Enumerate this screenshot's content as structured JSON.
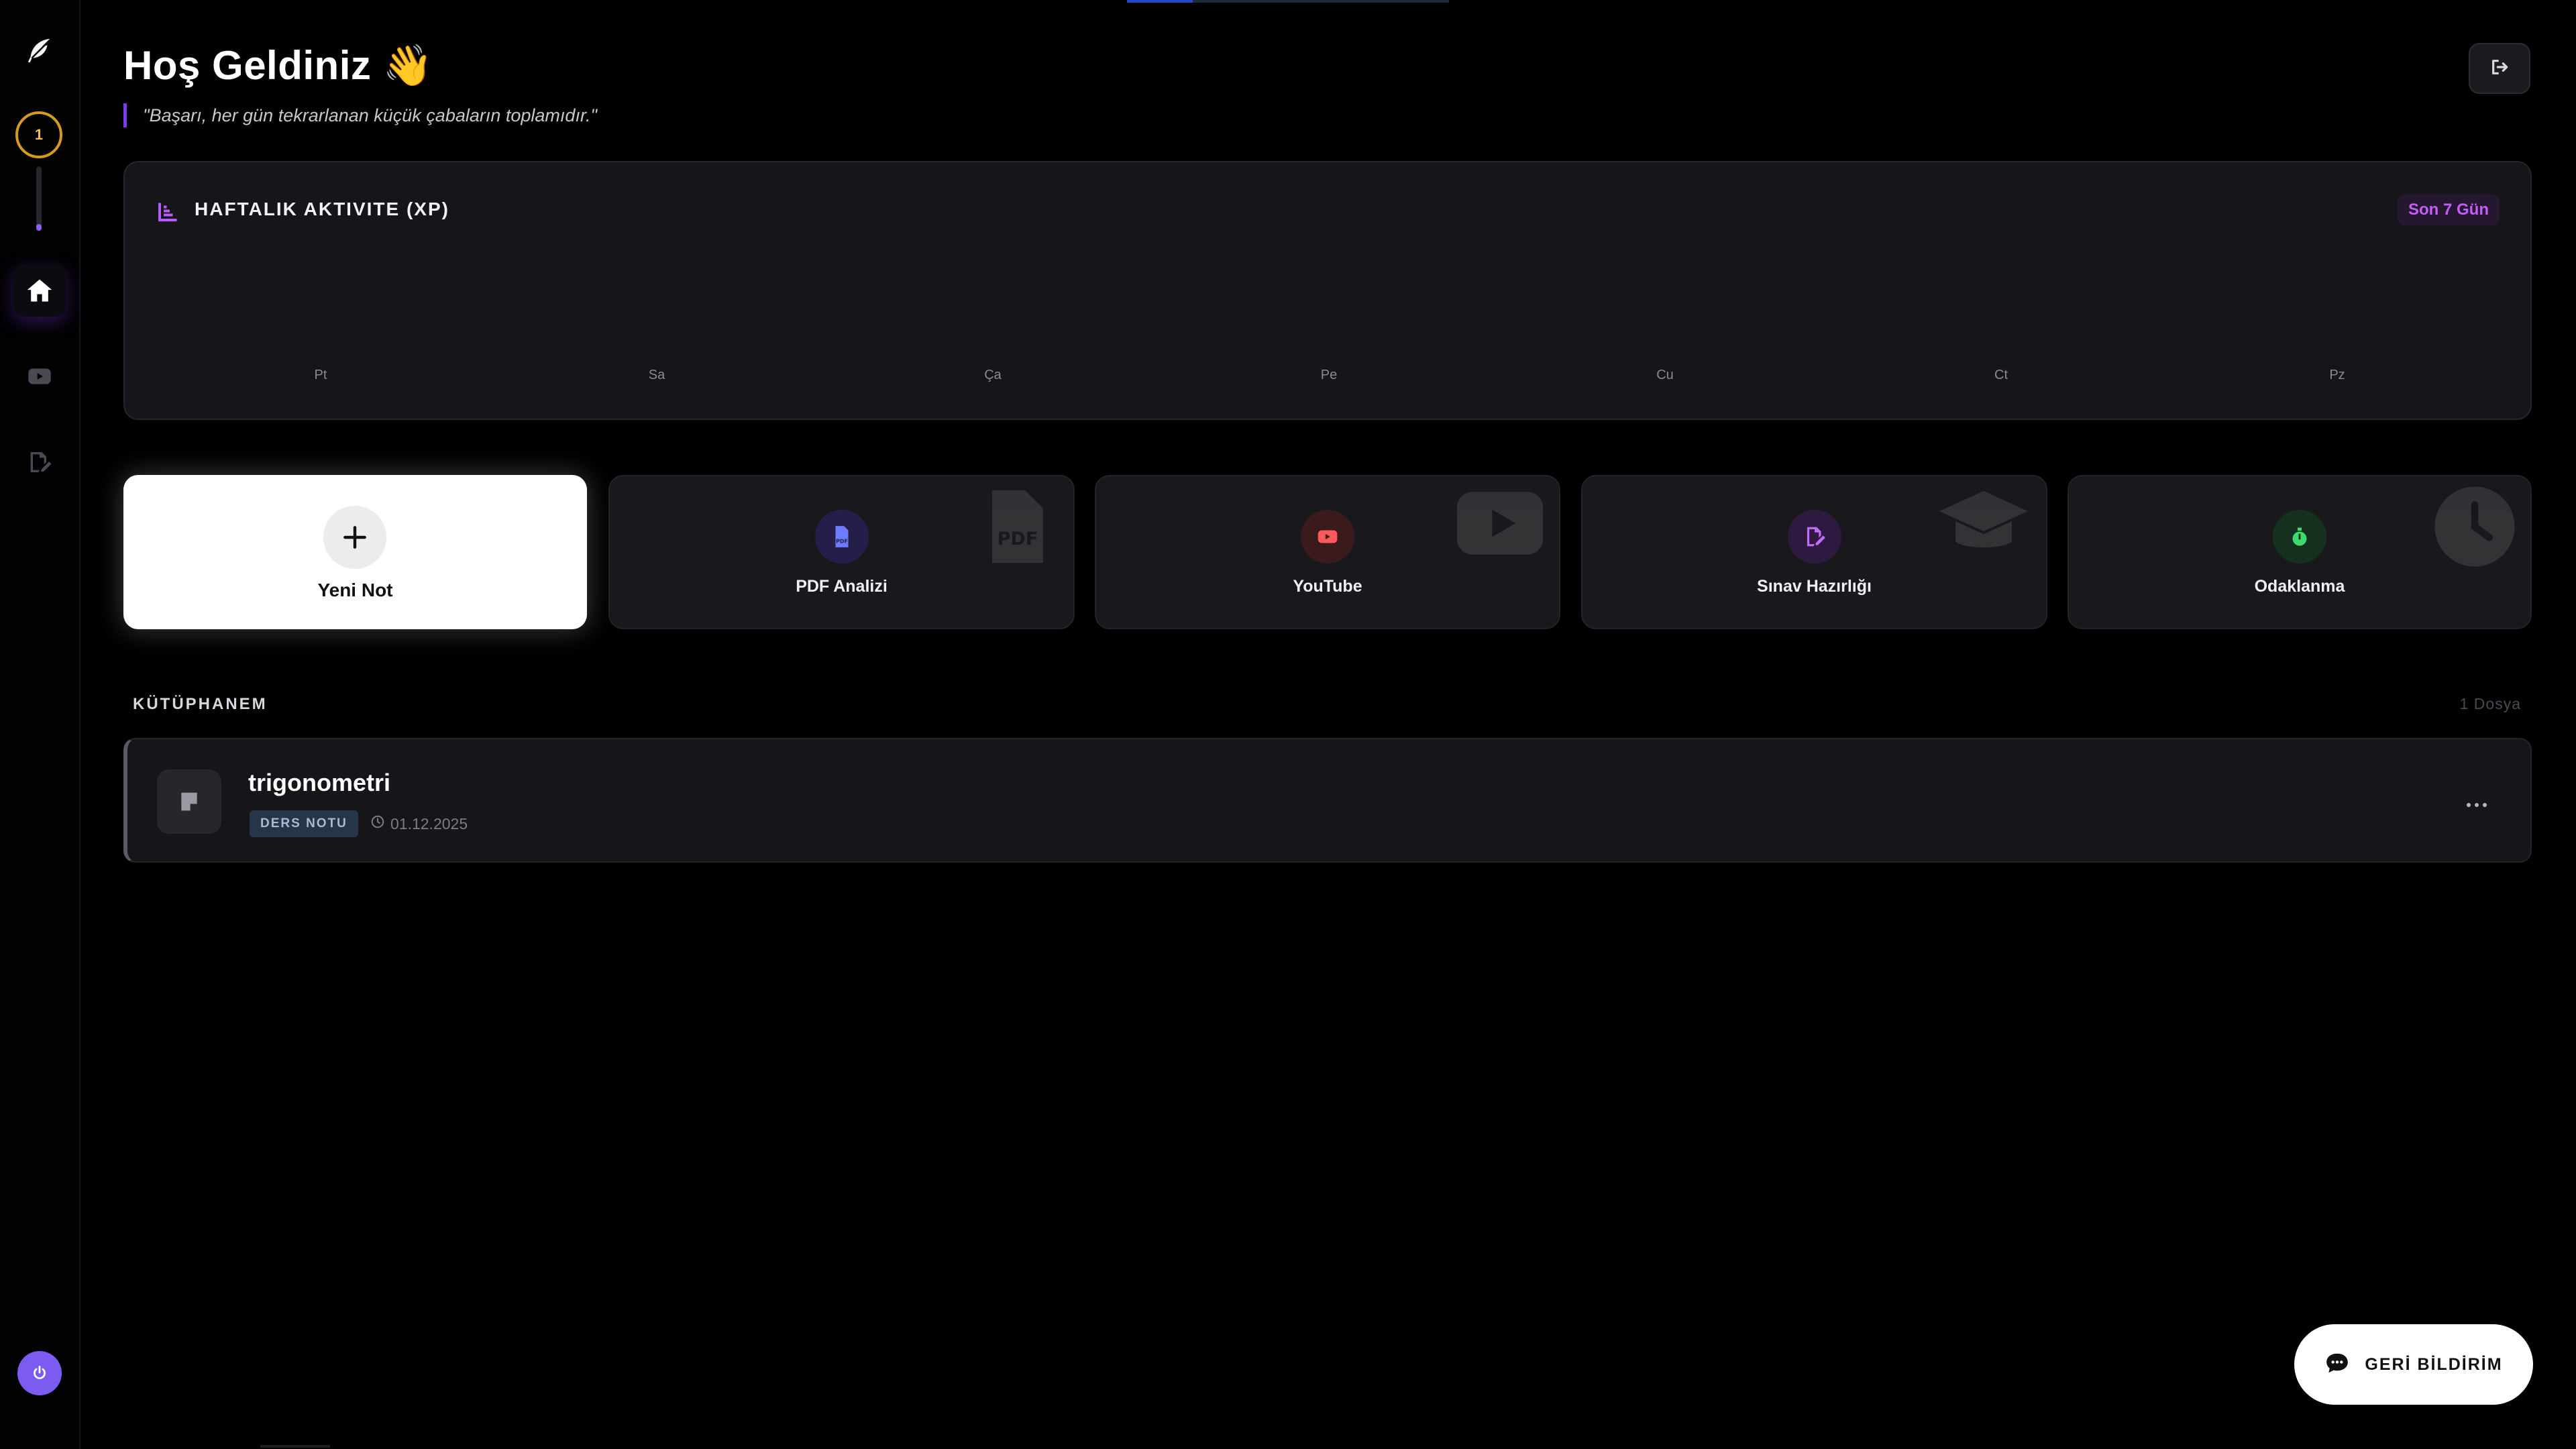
{
  "header": {
    "title": "Hoş Geldiniz 👋",
    "quote": "\"Başarı, her gün tekrarlanan küçük çabaların toplamıdır.\""
  },
  "sidebar": {
    "level": "1",
    "level_progress": 0.1,
    "items": [
      {
        "icon": "feather-icon"
      },
      {
        "icon": "home-icon",
        "active": true
      },
      {
        "icon": "youtube-icon"
      },
      {
        "icon": "exam-edit-icon"
      }
    ],
    "bottom_icon": "power-icon"
  },
  "activity": {
    "title": "HAFTALIK AKTIVITE (XP)",
    "range_label": "Son 7 Gün",
    "days": [
      "Pt",
      "Sa",
      "Ça",
      "Pe",
      "Cu",
      "Ct",
      "Pz"
    ]
  },
  "actions": {
    "new_note": "Yeni Not",
    "pdf": "PDF Analizi",
    "youtube": "YouTube",
    "exam": "Sınav Hazırlığı",
    "focus": "Odaklanma"
  },
  "library": {
    "title": "KÜTÜPHANEM",
    "count": "1 Dosya",
    "items": [
      {
        "name": "trigonometri",
        "tag": "DERS NOTU",
        "date": "01.12.2025"
      }
    ]
  },
  "feedback": {
    "label": "GERİ BİLDİRİM"
  },
  "colors": {
    "accent_purple": "#7c3aed",
    "pill_text": "#c45cff",
    "level_ring": "#d59b1c",
    "pdf": "#6d7cff",
    "youtube": "#ff5a5a",
    "exam": "#c06cff",
    "focus": "#3ddc6a"
  }
}
